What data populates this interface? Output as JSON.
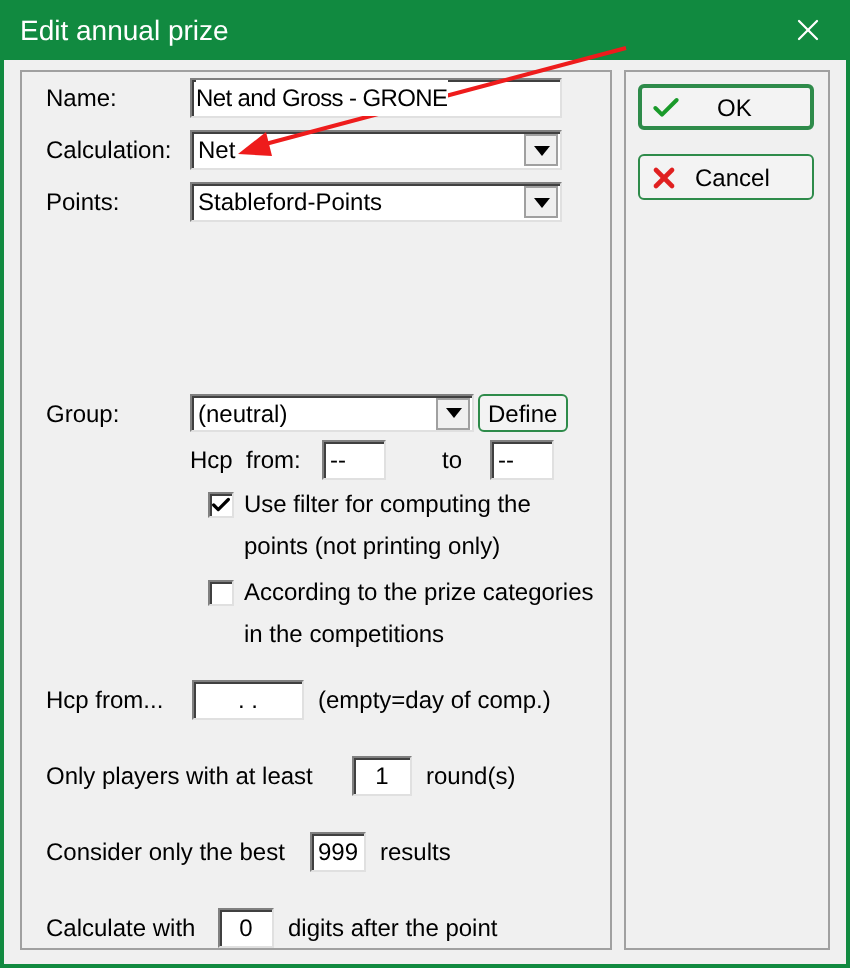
{
  "window": {
    "title": "Edit annual prize"
  },
  "fields": [
    {
      "label": "Name:",
      "kind": "text",
      "value": "Net and Gross - GRONE"
    },
    {
      "label": "Calculation:",
      "kind": "dropdown",
      "value": "Net"
    },
    {
      "label": "Points:",
      "kind": "dropdown",
      "value": "Stableford-Points"
    }
  ],
  "group": {
    "label": "Group:",
    "value": "(neutral)",
    "define_button": "Define",
    "hcp_label": "Hcp",
    "from_label": "from:",
    "from_value": "--",
    "to_label": "to",
    "to_value": "--"
  },
  "options": [
    {
      "lines": [
        "Use filter for computing the",
        "points (not printing only)"
      ],
      "checked": true
    },
    {
      "lines": [
        "According to the prize categories",
        "in the competitions"
      ],
      "checked": false
    }
  ],
  "settings": [
    {
      "label": "Hcp from...",
      "value": ". .",
      "suffix": "(empty=day of comp.)"
    },
    {
      "label": "Only players with at least",
      "value": "1",
      "suffix": "round(s)"
    },
    {
      "label": "Consider only the best",
      "value": "999",
      "suffix": "results"
    },
    {
      "label": "Calculate with",
      "value": "0",
      "suffix": "digits after the point"
    }
  ],
  "buttons": [
    {
      "label": "OK",
      "kind": "ok"
    },
    {
      "label": "Cancel",
      "kind": "cancel"
    }
  ]
}
